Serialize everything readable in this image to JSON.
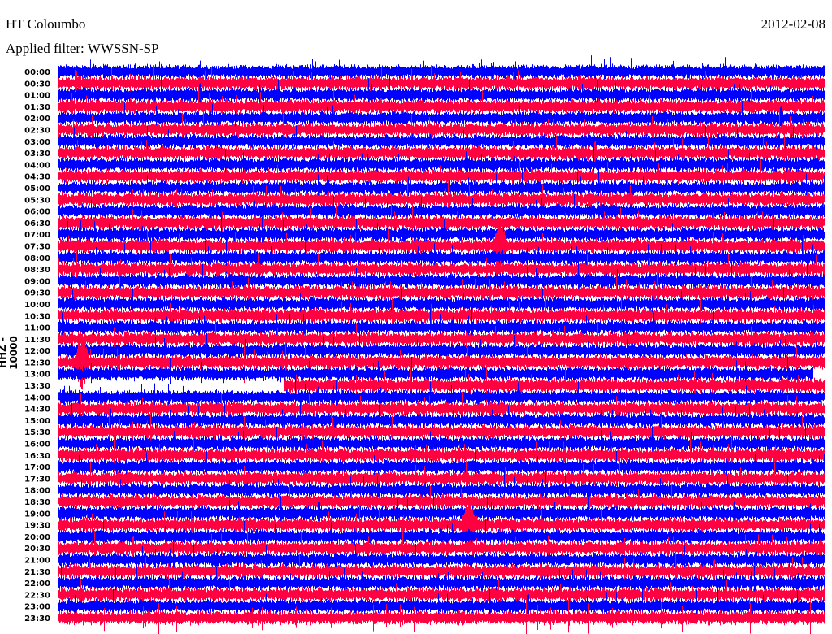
{
  "header": {
    "station": "HT Coloumbo",
    "date": "2012-02-08",
    "filter": "Applied filter: WWSSN-SP"
  },
  "chart_data": {
    "type": "line",
    "title": "HT Coloumbo",
    "ylabel": "HHZ - 10000",
    "colors": [
      "#0000ff",
      "#ff0040"
    ],
    "row_labels": [
      "00:00",
      "00:30",
      "01:00",
      "01:30",
      "02:00",
      "02:30",
      "03:00",
      "03:30",
      "04:00",
      "04:30",
      "05:00",
      "05:30",
      "06:00",
      "06:30",
      "07:00",
      "07:30",
      "08:00",
      "08:30",
      "09:00",
      "09:30",
      "10:00",
      "10:30",
      "11:00",
      "11:30",
      "12:00",
      "12:30",
      "13:00",
      "13:30",
      "14:00",
      "14:30",
      "15:00",
      "15:30",
      "16:00",
      "16:30",
      "17:00",
      "17:30",
      "18:00",
      "18:30",
      "19:00",
      "19:30",
      "20:00",
      "20:30",
      "21:00",
      "21:30",
      "22:00",
      "22:30",
      "23:00",
      "23:30"
    ],
    "gaps": [
      {
        "row": "13:00",
        "from_fraction": 0.984,
        "to_fraction": 1.0
      },
      {
        "row": "13:30",
        "from_fraction": 0.0,
        "to_fraction": 0.293
      }
    ],
    "events": [
      {
        "row": "07:30",
        "position_fraction": 0.575
      },
      {
        "row": "19:30",
        "position_fraction": 0.535
      },
      {
        "row": "12:30",
        "position_fraction": 0.03
      }
    ]
  }
}
